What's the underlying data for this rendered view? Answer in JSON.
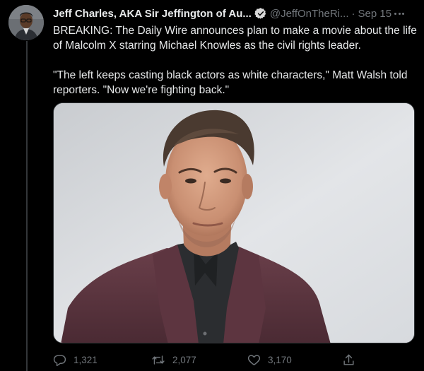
{
  "tweet": {
    "display_name": "Jeff Charles, AKA Sir Jeffington of Au...",
    "handle": "@JeffOnTheRi...",
    "separator": "·",
    "date": "Sep 15",
    "paragraphs": [
      "BREAKING: The Daily Wire announces plan to make a movie about the life of Malcolm X starring Michael Knowles as the civil rights leader.",
      "\"The left keeps casting black actors as white characters,\" Matt Walsh told reporters. \"Now we're fighting back.\""
    ],
    "actions": {
      "replies": "1,321",
      "retweets": "2,077",
      "likes": "3,170"
    }
  },
  "icons": {
    "verified": "verified-badge-icon",
    "more": "more-options-icon",
    "reply": "reply-icon",
    "retweet": "retweet-icon",
    "like": "heart-icon",
    "share": "share-icon"
  },
  "colors": {
    "background": "#000000",
    "text": "#e7e9ea",
    "secondary": "#71767b",
    "divider": "#333639"
  }
}
